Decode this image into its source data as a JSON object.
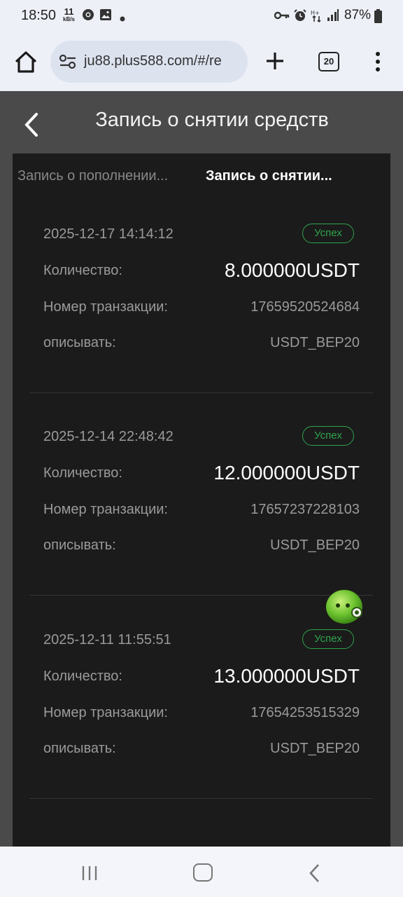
{
  "status_bar": {
    "time": "18:50",
    "net_speed_value": "11",
    "net_speed_unit": "kB/s",
    "battery": "87%"
  },
  "browser": {
    "url": "ju88.plus588.com/#/re",
    "tab_count": "20",
    "icons": [
      "home-icon",
      "site-settings-icon",
      "plus-icon",
      "tab-switcher-icon",
      "more-vert-icon"
    ]
  },
  "page": {
    "title": "Запись о снятии средств",
    "tabs": [
      {
        "label": "Запись о пополнении...",
        "active": false
      },
      {
        "label": "Запись о снятии...",
        "active": true
      }
    ]
  },
  "records": [
    {
      "date": "2025-12-17 14:14:12",
      "status": "Успех",
      "amount_label": "Количество:",
      "amount": "8.000000USDT",
      "tx_label": "Номер транзакции:",
      "tx": "17659520524684",
      "desc_label": "описывать:",
      "desc": "USDT_BEP20"
    },
    {
      "date": "2025-12-14 22:48:42",
      "status": "Успех",
      "amount_label": "Количество:",
      "amount": "12.000000USDT",
      "tx_label": "Номер транзакции:",
      "tx": "17657237228103",
      "desc_label": "описывать:",
      "desc": "USDT_BEP20"
    },
    {
      "date": "2025-12-11 11:55:51",
      "status": "Успех",
      "amount_label": "Количество:",
      "amount": "13.000000USDT",
      "tx_label": "Номер транзакции:",
      "tx": "17654253515329",
      "desc_label": "описывать:",
      "desc": "USDT_BEP20"
    }
  ],
  "colors": {
    "page_bg": "#4a4a4a",
    "panel_bg": "#1b1b1b",
    "success": "#2fa34b",
    "browser_bg": "#eef0f8"
  }
}
